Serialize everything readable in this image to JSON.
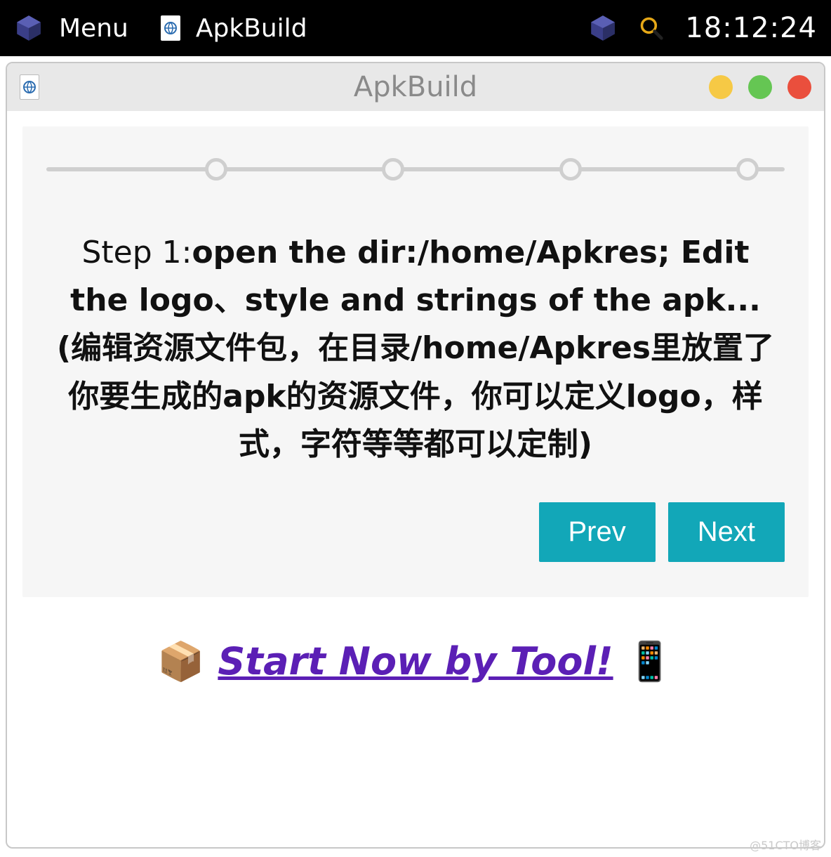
{
  "taskbar": {
    "menu_label": "Menu",
    "app_label": "ApkBuild",
    "clock": "18:12:24"
  },
  "window": {
    "title": "ApkBuild",
    "traffic": {
      "min": "yellow",
      "max": "green",
      "close": "red"
    }
  },
  "stepper": {
    "total": 4,
    "active": 1,
    "positions_pct": [
      23,
      47,
      71,
      95
    ]
  },
  "step": {
    "prefix": "Step 1:",
    "headline": "open the dir:/home/Apkres; Edit the logo、style and strings of the apk...",
    "sub_cn": "(编辑资源文件包，在目录/home/Apkres里放置了你要生成的apk的资源文件，你可以定义logo，样式，字符等等都可以定制)"
  },
  "buttons": {
    "prev": "Prev",
    "next": "Next"
  },
  "cta": {
    "package_emoji": "📦",
    "label": "Start Now by Tool!",
    "phone_emoji": "📱"
  },
  "watermark": "@51CTO博客"
}
